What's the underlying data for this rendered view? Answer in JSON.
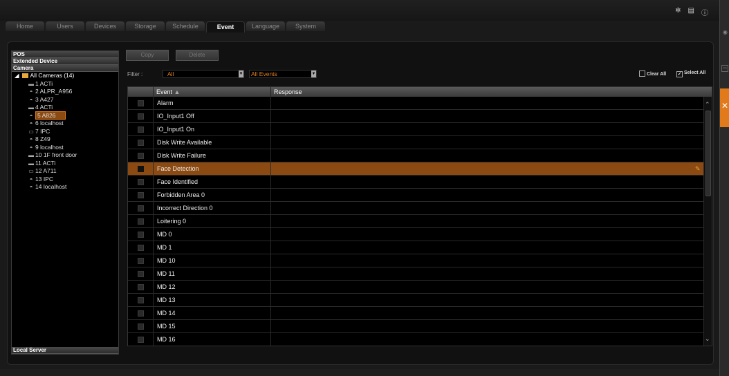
{
  "tabs": [
    "Home",
    "Users",
    "Devices",
    "Storage",
    "Schedule",
    "Event",
    "Language",
    "System"
  ],
  "active_tab": "Event",
  "left_panel": {
    "sections": [
      "POS",
      "Extended Device",
      "Camera"
    ],
    "root": "All Cameras (14)",
    "cameras": [
      {
        "label": "1 ACTi",
        "icon": "box-camera-icon"
      },
      {
        "label": "2 ALPR_A956",
        "icon": "dome-camera-icon"
      },
      {
        "label": "3 A427",
        "icon": "dome-camera-icon"
      },
      {
        "label": "4 ACTi",
        "icon": "box-camera-icon"
      },
      {
        "label": "5 A826",
        "icon": "dome-camera-icon",
        "selected": true
      },
      {
        "label": "6 localhost",
        "icon": "dome-camera-icon"
      },
      {
        "label": "7 IPC",
        "icon": "bullet-camera-icon"
      },
      {
        "label": "8 Z49",
        "icon": "dome-camera-icon"
      },
      {
        "label": "9 localhost",
        "icon": "dome-camera-icon"
      },
      {
        "label": "10 1F front door",
        "icon": "box-camera-icon"
      },
      {
        "label": "11 ACTi",
        "icon": "box-camera-icon"
      },
      {
        "label": "12 A711",
        "icon": "bullet-camera-icon"
      },
      {
        "label": "13 IPC",
        "icon": "dome-camera-icon"
      },
      {
        "label": "14 localhost",
        "icon": "dome-camera-icon"
      }
    ],
    "footer_section": "Local Server"
  },
  "toolbar": {
    "copy": "Copy",
    "delete": "Delete"
  },
  "filter": {
    "label": "Filter :",
    "value1": "All",
    "value2": "All Events"
  },
  "clear_all": "Clear All",
  "select_all": "Select All",
  "grid": {
    "headers": {
      "event": "Event",
      "response": "Response"
    },
    "rows": [
      "Alarm",
      "IO_Input1 Off",
      "IO_Input1 On",
      "Disk Write Available",
      "Disk Write Failure",
      "Face Detection",
      "Face Identified",
      "Forbidden Area 0",
      "Incorrect Direction 0",
      "Loitering 0",
      "MD 0",
      "MD 1",
      "MD 10",
      "MD 11",
      "MD 12",
      "MD 13",
      "MD 14",
      "MD 15",
      "MD 16"
    ],
    "highlighted_index": 5
  },
  "colors": {
    "accent": "#e07a1a",
    "highlight": "#8b4a12",
    "filter_text": "#e08020"
  }
}
